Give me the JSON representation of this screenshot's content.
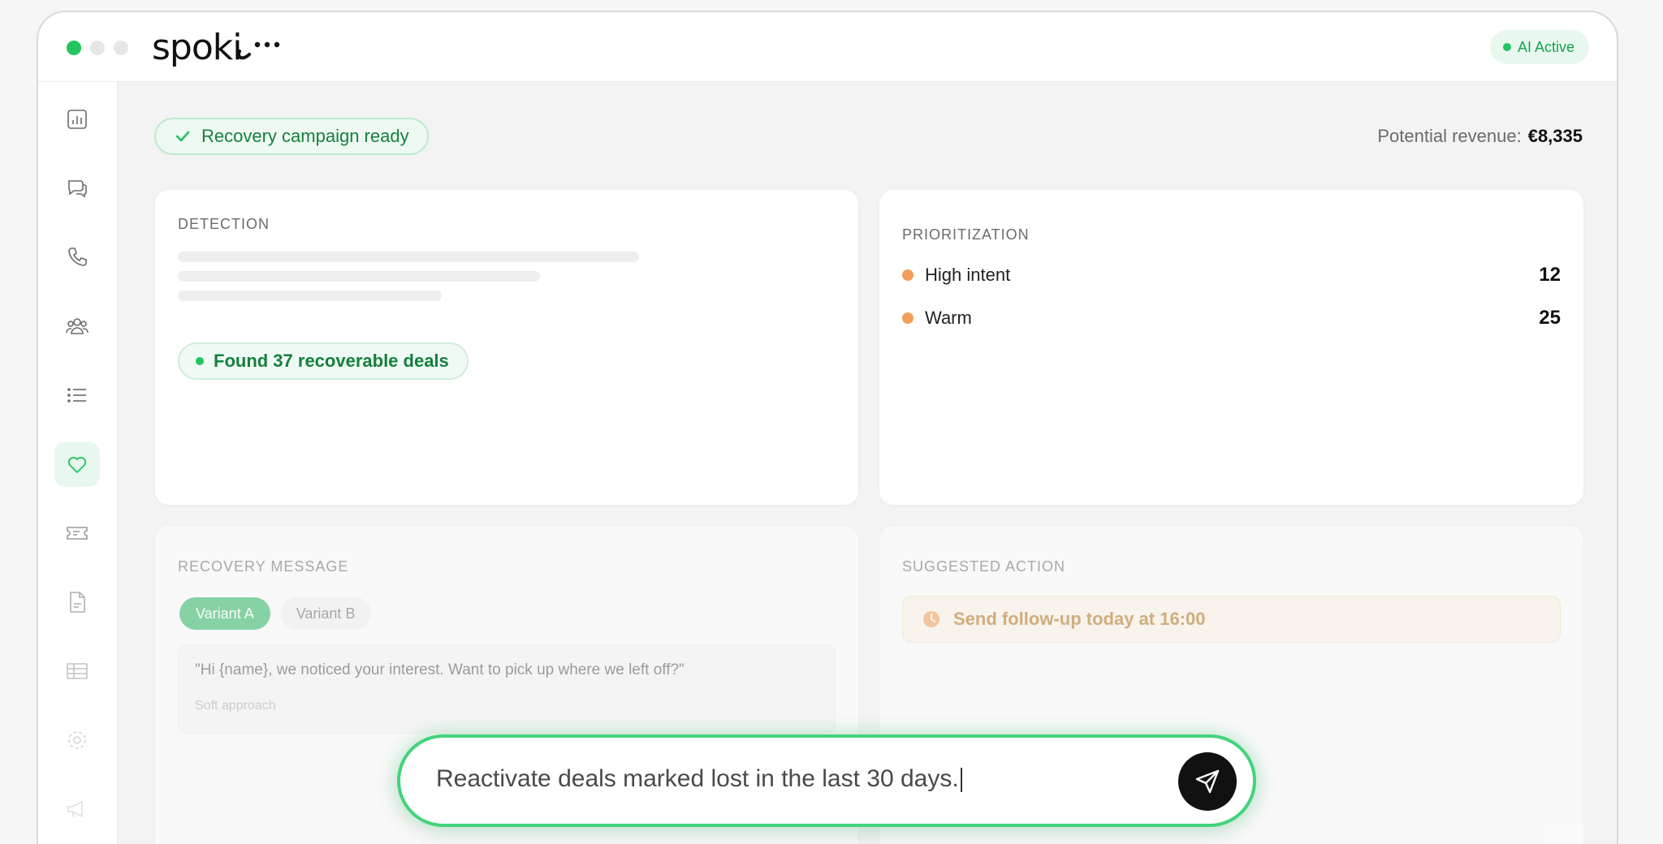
{
  "app": {
    "logo_text": "spoki",
    "status_badge": "AI Active"
  },
  "sidebar": {
    "items": [
      {
        "icon": "bar-chart-icon",
        "active": false
      },
      {
        "icon": "chat-bubbles-icon",
        "active": false
      },
      {
        "icon": "phone-icon",
        "active": false
      },
      {
        "icon": "users-icon",
        "active": false
      },
      {
        "icon": "list-icon",
        "active": false
      },
      {
        "icon": "heart-icon",
        "active": true
      },
      {
        "icon": "ticket-icon",
        "active": false
      },
      {
        "icon": "document-icon",
        "active": false
      },
      {
        "icon": "table-icon",
        "active": false
      },
      {
        "icon": "gear-icon",
        "active": false
      },
      {
        "icon": "megaphone-icon",
        "active": false
      }
    ]
  },
  "header": {
    "campaign_status": "Recovery campaign ready",
    "revenue_label": "Potential revenue:",
    "revenue_value": "€8,335"
  },
  "detection": {
    "title": "DETECTION",
    "found_label": "Found 37 recoverable deals"
  },
  "prioritization": {
    "title": "PRIORITIZATION",
    "rows": [
      {
        "label": "High intent",
        "count": "12"
      },
      {
        "label": "Warm",
        "count": "25"
      }
    ]
  },
  "recovery_message": {
    "title": "RECOVERY MESSAGE",
    "variants": [
      "Variant A",
      "Variant B"
    ],
    "selected_variant": "Variant A",
    "message": "\"Hi {name}, we noticed your interest. Want to pick up where we left off?\"",
    "hint": "Soft approach"
  },
  "suggested_action": {
    "title": "SUGGESTED ACTION",
    "action": "Send follow-up today at 16:00"
  },
  "prompt": {
    "value": "Reactivate deals marked lost in the last 30 days."
  },
  "colors": {
    "accent": "#22c55e",
    "accent_text": "#15803d",
    "warm_dot": "#f0a05a",
    "action_text": "#b5741f"
  }
}
